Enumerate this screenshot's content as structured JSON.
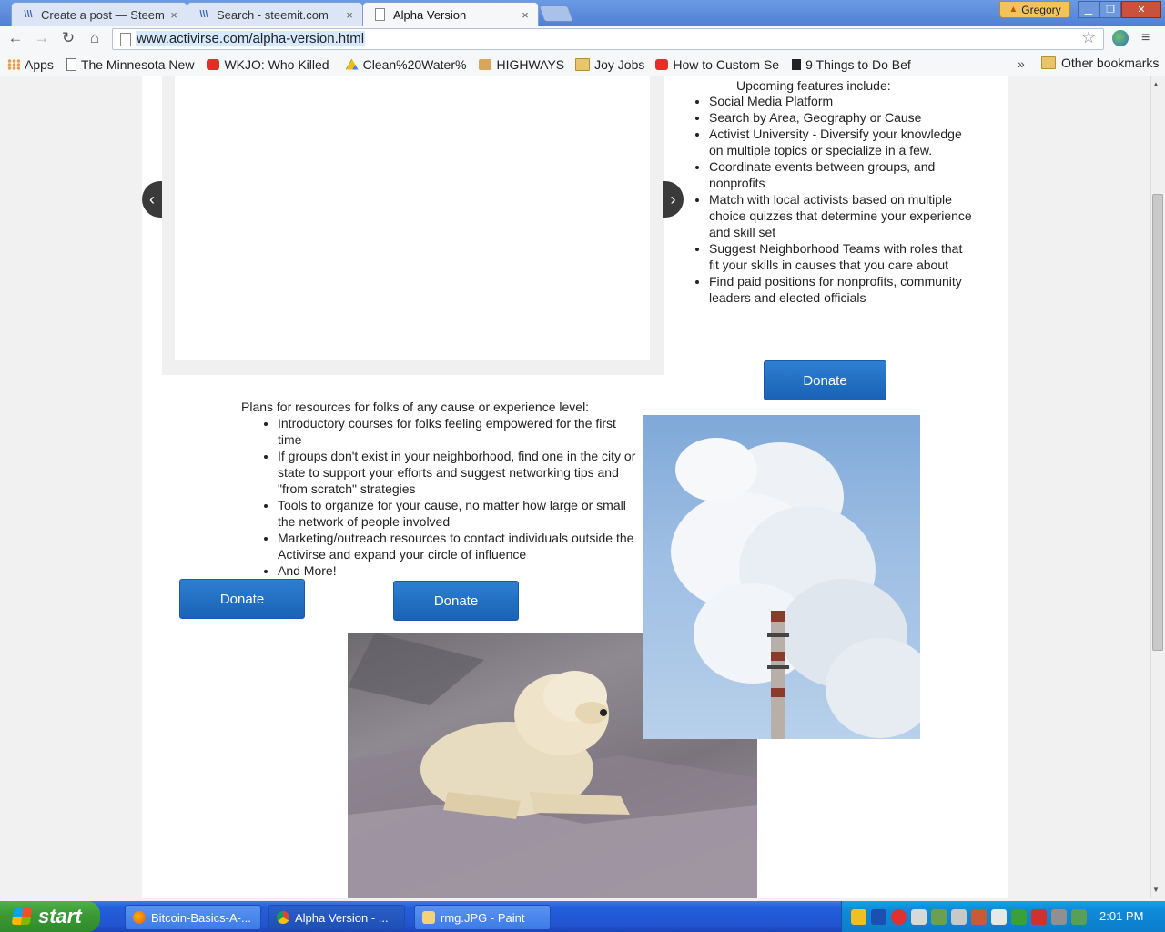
{
  "browser": {
    "tabs": [
      {
        "label": "Create a post — Steem",
        "icon": "steem-icon"
      },
      {
        "label": "Search - steemit.com",
        "icon": "steem-icon"
      },
      {
        "label": "Alpha Version",
        "icon": "page-icon"
      }
    ],
    "profile_name": "Gregory",
    "url": "www.activirse.com/alpha-version.html",
    "bookmarks": [
      {
        "label": "Apps",
        "icon": "apps-icon"
      },
      {
        "label": "The Minnesota New",
        "icon": "page-icon"
      },
      {
        "label": "WKJO: Who Killed",
        "icon": "youtube-icon"
      },
      {
        "label": "Clean%20Water%",
        "icon": "drive-icon"
      },
      {
        "label": "HIGHWAYS",
        "icon": "highways-icon"
      },
      {
        "label": "Joy Jobs",
        "icon": "folder-icon"
      },
      {
        "label": "How to Custom Se",
        "icon": "youtube-icon"
      },
      {
        "label": "9 Things to Do Bef",
        "icon": "instructables-icon"
      }
    ],
    "bookmarks_more": "»",
    "other_bookmarks": "Other bookmarks"
  },
  "page": {
    "features_title": "Upcoming features include:",
    "features": [
      "Social Media Platform",
      "Search by Area, Geography or Cause",
      "Activist University - Diversify your knowledge on multiple topics or specialize in a few.",
      "Coordinate events between groups, and nonprofits",
      "Match with local activists based on multiple choice quizzes that determine your experience and skill set",
      "Suggest Neighborhood Teams with roles that fit your skills in causes that you care about",
      "Find paid positions for nonprofits, community leaders and elected officials"
    ],
    "resources_title": "Plans for resources for folks of any cause or experience level:",
    "resources": [
      "Introductory courses for folks feeling empowered for the first time",
      "If groups don't exist in your neighborhood, find one in the city or state to support your efforts and suggest networking tips and \"from scratch\" strategies",
      "Tools to organize for your cause, no matter how large or small the network of people involved",
      "Marketing/outreach resources to contact individuals outside the Activirse and expand your circle of influence",
      "And More!"
    ],
    "donate_label": "Donate",
    "slider_prev": "‹",
    "slider_next": "›"
  },
  "taskbar": {
    "start_label": "start",
    "tasks": [
      {
        "label": "Bitcoin-Basics-A-...",
        "icon": "firefox-icon"
      },
      {
        "label": "Alpha Version - ...",
        "icon": "chrome-icon"
      },
      {
        "label": "rmg.JPG - Paint",
        "icon": "paint-icon"
      }
    ],
    "clock": "2:01 PM"
  }
}
